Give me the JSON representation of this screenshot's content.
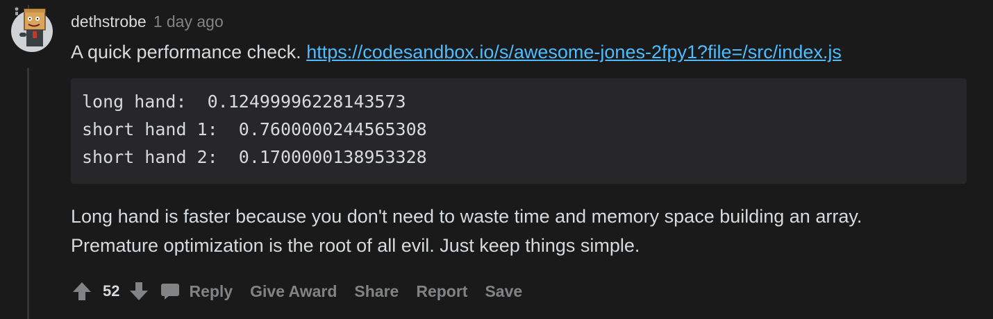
{
  "comment": {
    "username": "dethstrobe",
    "timestamp": "1 day ago",
    "intro_text": "A quick performance check.",
    "link_text": "https://codesandbox.io/s/awesome-jones-2fpy1?file=/src/index.js",
    "code_lines": [
      "long hand:  0.12499996228143573",
      "short hand 1:  0.7600000244565308",
      "short hand 2:  0.1700000138953328"
    ],
    "body_lines": [
      "Long hand is faster because you don't need to waste time and memory space building an array.",
      "Premature optimization is the root of all evil. Just keep things simple."
    ]
  },
  "actions": {
    "score": "52",
    "reply": "Reply",
    "give_award": "Give Award",
    "share": "Share",
    "report": "Report",
    "save": "Save"
  },
  "icons": {
    "upvote": "arrow-up-icon",
    "downvote": "arrow-down-icon",
    "reply": "speech-bubble-icon",
    "avatar": "snoo-avatar"
  },
  "colors": {
    "background": "#1a1a1b",
    "code_background": "#272729",
    "text": "#d7dadc",
    "muted": "#818384",
    "link": "#4fbcff",
    "thread_line": "#343536"
  }
}
